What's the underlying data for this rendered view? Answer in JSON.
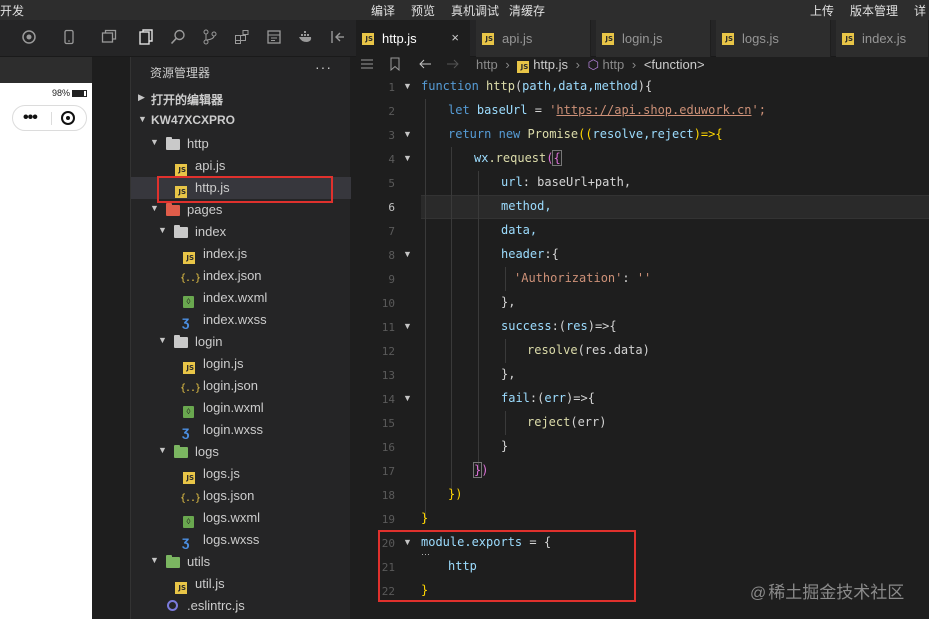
{
  "menubar": {
    "left_fragment": "开发",
    "items": [
      "编译",
      "预览",
      "真机调试",
      "清缓存"
    ],
    "right_items": [
      "上传",
      "版本管理",
      "详"
    ]
  },
  "toolbar": {
    "icons": [
      "record-icon",
      "phone-icon",
      "window-icon",
      "explorer-icon",
      "search-icon",
      "source-control-icon",
      "extensions-icon",
      "debug-icon",
      "docker-icon",
      "collapse-panel-icon"
    ]
  },
  "tabs": [
    {
      "label": "http.js",
      "active": true,
      "close": "×"
    },
    {
      "label": "api.js",
      "active": false
    },
    {
      "label": "login.js",
      "active": false
    },
    {
      "label": "logs.js",
      "active": false
    },
    {
      "label": "index.js",
      "active": false
    }
  ],
  "simulator": {
    "battery": "98%"
  },
  "explorer": {
    "title": "资源管理器",
    "more": "···",
    "open_editors": "打开的编辑器",
    "project": "KW47XCXPRO",
    "tree": [
      {
        "label": "http",
        "type": "folder"
      },
      {
        "label": "api.js",
        "type": "js"
      },
      {
        "label": "http.js",
        "type": "js"
      },
      {
        "label": "pages",
        "type": "folder"
      },
      {
        "label": "index",
        "type": "folder"
      },
      {
        "label": "index.js",
        "type": "js"
      },
      {
        "label": "index.json",
        "type": "json"
      },
      {
        "label": "index.wxml",
        "type": "wxml"
      },
      {
        "label": "index.wxss",
        "type": "wxss"
      },
      {
        "label": "login",
        "type": "folder"
      },
      {
        "label": "login.js",
        "type": "js"
      },
      {
        "label": "login.json",
        "type": "json"
      },
      {
        "label": "login.wxml",
        "type": "wxml"
      },
      {
        "label": "login.wxss",
        "type": "wxss"
      },
      {
        "label": "logs",
        "type": "folder"
      },
      {
        "label": "logs.js",
        "type": "js"
      },
      {
        "label": "logs.json",
        "type": "json"
      },
      {
        "label": "logs.wxml",
        "type": "wxml"
      },
      {
        "label": "logs.wxss",
        "type": "wxss"
      },
      {
        "label": "utils",
        "type": "folder"
      },
      {
        "label": "util.js",
        "type": "js"
      },
      {
        "label": ".eslintrc.js",
        "type": "eslint"
      }
    ]
  },
  "breadcrumb": {
    "items": [
      "http",
      "http.js",
      "http",
      "<function>"
    ]
  },
  "editor": {
    "current_line": 6,
    "line_numbers": [
      "1",
      "2",
      "3",
      "4",
      "5",
      "6",
      "7",
      "8",
      "9",
      "10",
      "11",
      "12",
      "13",
      "14",
      "15",
      "16",
      "17",
      "18",
      "19",
      "20",
      "21",
      "22"
    ],
    "code": {
      "l1_kw": "function",
      "l1_fn": "http",
      "l1_p1": "(",
      "l1_params": "path,data,method",
      "l1_p2": "){",
      "l2_kw": "let",
      "l2_var": "baseUrl",
      "l2_eq": " = ",
      "l2_q1": "'",
      "l2_url": "https://api.shop.eduwork.cn",
      "l2_q2": "';",
      "l3_kw": "return",
      "l3_new": "new",
      "l3_cls": "Promise",
      "l3_p": "((",
      "l3_params": "resolve,reject",
      "l3_arrow": ")=>{",
      "l4_obj": "wx",
      "l4_fn": ".request",
      "l4_p": "(",
      "l4_b": "{",
      "l5_key": "url",
      "l5_rest": ": baseUrl+path,",
      "l6": "method,",
      "l7": "data,",
      "l8_key": "header",
      "l8_rest": ":{",
      "l9_str": "'Authorization'",
      "l9_colon": ": ",
      "l9_val": "''",
      "l10": "},",
      "l11_key": "success",
      "l11_rest": ":(",
      "l11_arg": "res",
      "l11_end": ")=>{",
      "l12_fn": "resolve",
      "l12_arg": "(res.data)",
      "l13": "},",
      "l14_key": "fail",
      "l14_rest": ":(",
      "l14_arg": "err",
      "l14_end": ")=>{",
      "l15_fn": "reject",
      "l15_arg": "(err)",
      "l16": "}",
      "l17_b": "}",
      "l17_p": ")",
      "l18": "})",
      "l19": "}",
      "l20_mod": "module",
      "l20_exp": ".exports",
      "l20_rest": " = {",
      "l21": "http",
      "l22": "}"
    }
  },
  "annotation": {
    "color": "#e0312d"
  },
  "watermark": {
    "at": "@",
    "text": "稀土掘金技术社区"
  }
}
